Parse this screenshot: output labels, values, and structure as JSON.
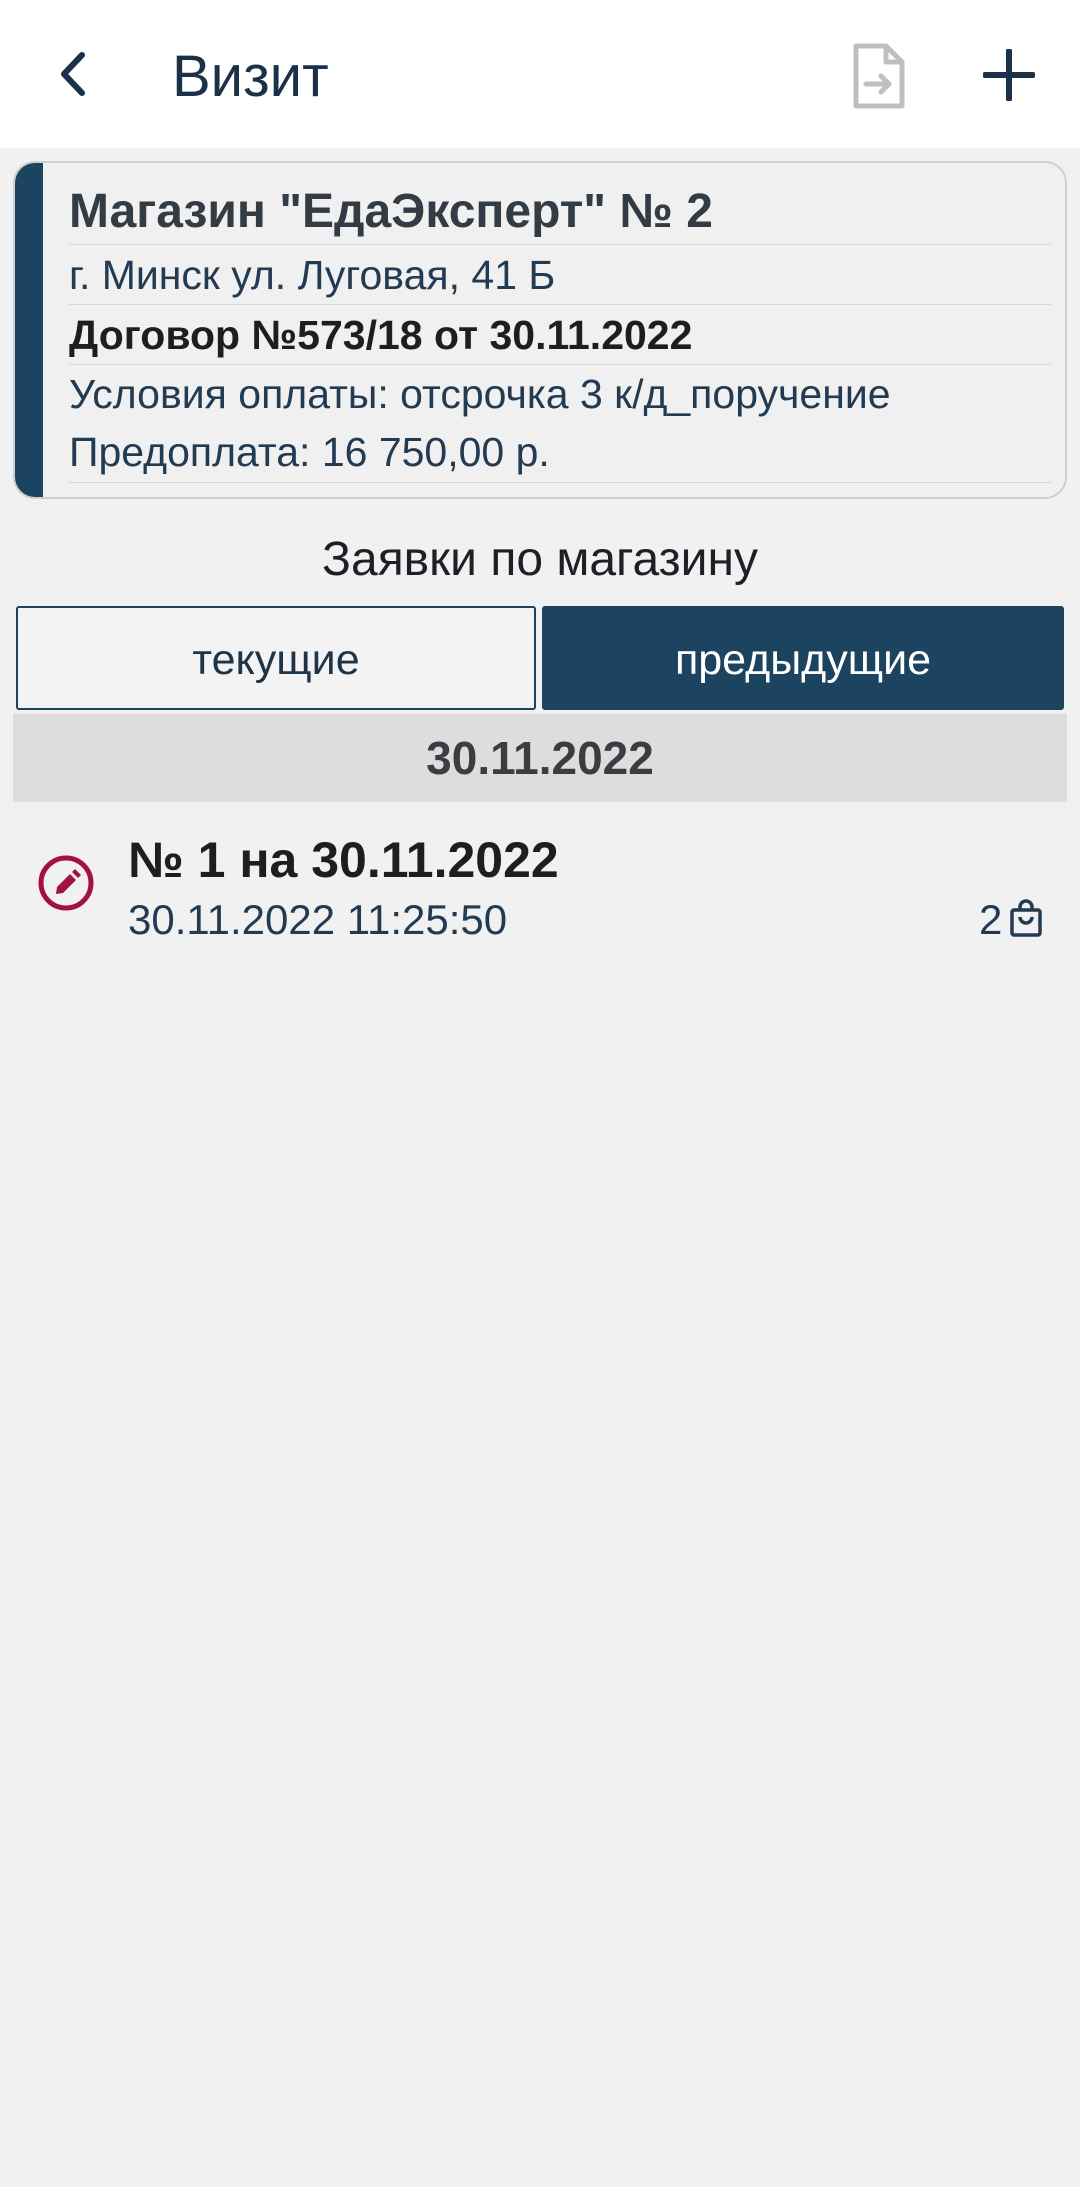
{
  "header": {
    "title": "Визит",
    "back_icon": "chevron-left-icon",
    "document_icon": "document-export-icon",
    "add_icon": "plus-icon"
  },
  "shop": {
    "name": "Магазин \"ЕдаЭксперт\" № 2",
    "address": "г. Минск ул. Луговая, 41 Б",
    "contract": "Договор №573/18 от 30.11.2022",
    "payment_terms": "Условия оплаты: отсрочка 3 к/д_поручение",
    "prepayment": "Предоплата: 16 750,00 р."
  },
  "orders_section": {
    "title": "Заявки по магазину",
    "tabs": [
      {
        "label": "текущие",
        "selected": false
      },
      {
        "label": "предыдущие",
        "selected": true
      }
    ]
  },
  "groups": [
    {
      "date": "30.11.2022",
      "orders": [
        {
          "title": "№ 1 на 30.11.2022",
          "datetime": "30.11.2022 11:25:50",
          "count": "2",
          "status_icon": "edit-icon",
          "count_icon": "shopping-bag-icon"
        }
      ]
    }
  ],
  "colors": {
    "accent": "#1c4460",
    "edit_status": "#a3123f",
    "background": "#f1f1f1"
  }
}
